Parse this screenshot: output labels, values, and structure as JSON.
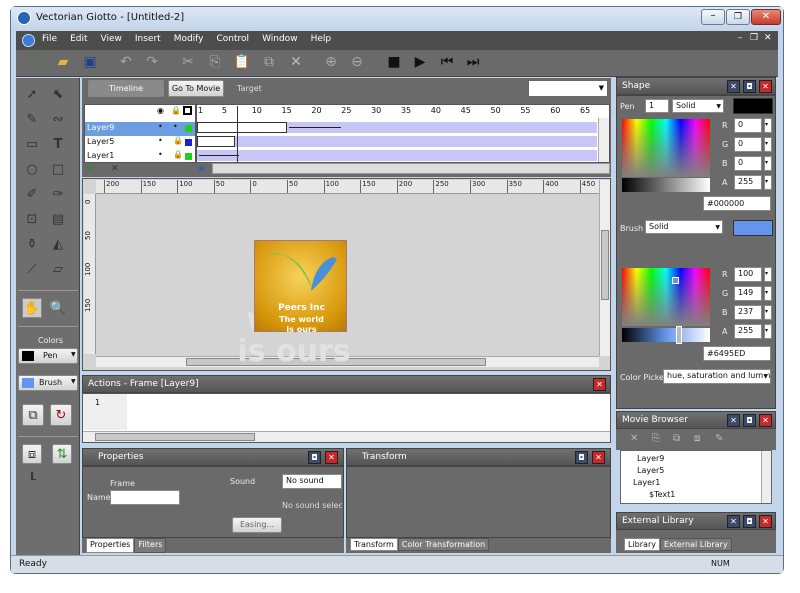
{
  "window": {
    "title": "Vectorian Giotto - [Untitled-2]"
  },
  "menu": [
    "File",
    "Edit",
    "View",
    "Insert",
    "Modify",
    "Control",
    "Window",
    "Help"
  ],
  "timeline": {
    "timeline_btn": "Timeline",
    "goto_btn": "Go To Movie",
    "target_label": "Target",
    "frames": [
      "1",
      "5",
      "10",
      "15",
      "20",
      "25",
      "30",
      "35",
      "40",
      "45",
      "50",
      "55",
      "60",
      "65"
    ],
    "layers": [
      "Layer9",
      "Layer5",
      "Layer1"
    ]
  },
  "ruler": {
    "h": [
      "200",
      "150",
      "100",
      "50",
      "0",
      "50",
      "100",
      "150",
      "200",
      "250",
      "300",
      "350",
      "400",
      "450"
    ],
    "v": [
      "0",
      "50",
      "100",
      "150"
    ]
  },
  "stage": {
    "ghost1": "The world",
    "ghost2": "is ours",
    "logo_title": "Peers Inc",
    "logo_sub1": "The world",
    "logo_sub2": "is ours"
  },
  "colors_panel": {
    "label": "Colors",
    "pen": "Pen",
    "brush": "Brush",
    "pen_color": "#000000",
    "brush_color": "#6495ED"
  },
  "actions": {
    "title": "Actions - Frame [Layer9]",
    "line": "1"
  },
  "properties": {
    "title": "Properties",
    "frame_label": "Frame",
    "name_label": "Name",
    "sound_label": "Sound",
    "sound_value": "No sound",
    "sound_note": "No sound selected",
    "easing_btn": "Easing...",
    "tabs": [
      "Properties",
      "Filters"
    ]
  },
  "transform": {
    "title": "Transform",
    "tabs": [
      "Transform",
      "Color Transformation"
    ]
  },
  "shape": {
    "title": "Shape",
    "pen_label": "Pen",
    "pen_width": "1",
    "pen_style": "Solid",
    "pen_r": "0",
    "pen_g": "0",
    "pen_b": "0",
    "pen_a": "255",
    "pen_hex": "#000000",
    "brush_label": "Brush",
    "brush_style": "Solid",
    "brush_r": "100",
    "brush_g": "149",
    "brush_b": "237",
    "brush_a": "255",
    "brush_hex": "#6495ED",
    "r": "R",
    "g": "G",
    "b": "B",
    "a": "A",
    "picker_label": "Color Picker",
    "picker_value": "hue, saturation and lumin"
  },
  "movie_browser": {
    "title": "Movie Browser",
    "items": [
      "Layer9",
      "Layer5",
      "Layer1",
      "$Text1"
    ]
  },
  "library": {
    "title": "External Library",
    "tabs": [
      "Library",
      "External Library"
    ]
  },
  "status": {
    "left": "Ready",
    "right": "NUM"
  }
}
